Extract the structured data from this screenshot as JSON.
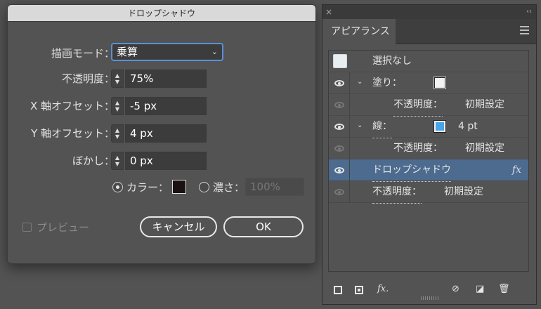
{
  "dialog": {
    "title": "ドロップシャドウ",
    "mode": {
      "label": "描画モード：",
      "value": "乗算"
    },
    "opacity": {
      "label": "不透明度：",
      "value": "75%"
    },
    "x_offset": {
      "label": "X 軸オフセット：",
      "value": "-5 px"
    },
    "y_offset": {
      "label": "Y 軸オフセット：",
      "value": "4 px"
    },
    "blur": {
      "label": "ぼかし：",
      "value": "0 px"
    },
    "color_option": {
      "label": "カラー：",
      "selected": true,
      "swatch_color": "#1a1212"
    },
    "darkness_option": {
      "label": "濃さ：",
      "value": "100%",
      "selected": false
    },
    "preview": {
      "label": "プレビュー",
      "checked": false
    },
    "cancel_label": "キャンセル",
    "ok_label": "OK"
  },
  "panel": {
    "tab_label": "アピアランス",
    "selection_label": "選択なし",
    "rows": [
      {
        "label": "塗り：",
        "swatch_color": "#f2f2f2"
      },
      {
        "label": "不透明度：",
        "value": "初期設定"
      },
      {
        "label": "線：",
        "swatch_color": "#4aa3e8",
        "value": "4 pt"
      },
      {
        "label": "不透明度：",
        "value": "初期設定"
      },
      {
        "label": "ドロップシャドウ",
        "fx": "fx"
      },
      {
        "label": "不透明度：",
        "value": "初期設定"
      }
    ],
    "accent_selected_row": "#4c6b8f",
    "footer_icons": [
      "add-stroke-icon",
      "add-fill-icon",
      "add-effect-icon",
      "clear-appearance-icon",
      "duplicate-item-icon",
      "delete-icon"
    ],
    "footer_fx_glyph": "fx."
  },
  "icons": {
    "close": "×",
    "collapse": "‹‹",
    "chevron": "⌄",
    "caret": "⌄",
    "spin_up": "▲",
    "spin_down": "▼"
  }
}
